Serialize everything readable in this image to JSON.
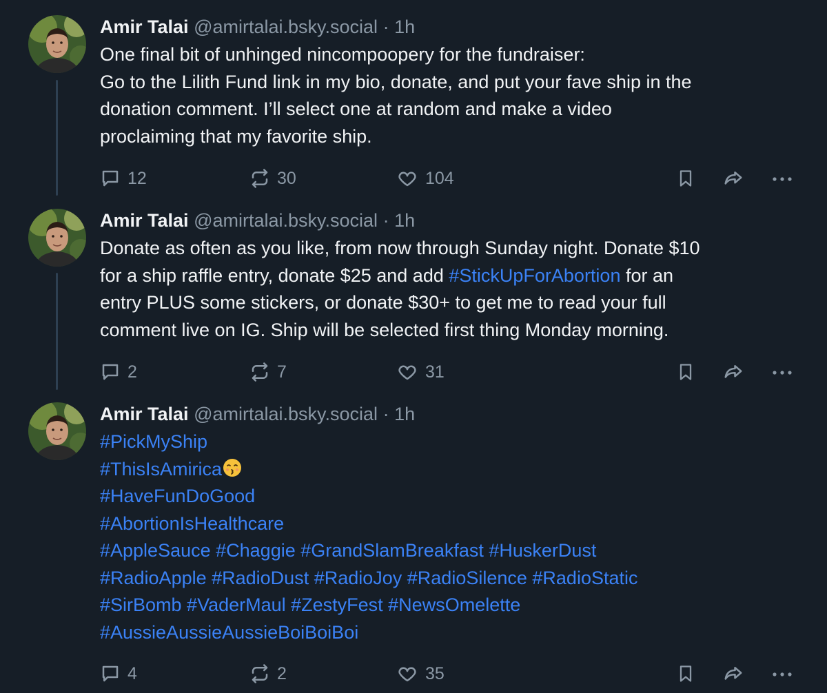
{
  "posts": [
    {
      "author": "Amir Talai",
      "handle": "@amirtalai.bsky.social",
      "separator": "·",
      "time": "1h",
      "lines": [
        "One final bit of unhinged nincompoopery for the fundraiser:",
        "Go to the Lilith Fund link in my bio, donate, and put your fave ship in the",
        "donation comment. I’ll select one at random and make a video",
        "proclaiming that my favorite ship."
      ],
      "replies": "12",
      "reposts": "30",
      "likes": "104"
    },
    {
      "author": "Amir Talai",
      "handle": "@amirtalai.bsky.social",
      "separator": "·",
      "time": "1h",
      "line1": "Donate as often as you like, from now through Sunday night. Donate $10",
      "line2_before": "for a ship raffle entry, donate $25 and add ",
      "line2_tag": "#StickUpForAbortion",
      "line2_after": " for an",
      "line3": "entry PLUS some stickers, or donate $30+ to get me to read your full",
      "line4": "comment live on IG. Ship will be selected first thing Monday morning.",
      "replies": "2",
      "reposts": "7",
      "likes": "31"
    },
    {
      "author": "Amir Talai",
      "handle": "@amirtalai.bsky.social",
      "separator": "·",
      "time": "1h",
      "tag_lines": [
        "#PickMyShip",
        "#ThisIsAmirica",
        "#HaveFunDoGood",
        "#AbortionIsHealthcare",
        "#AppleSauce #Chaggie #GrandSlamBreakfast #HuskerDust",
        "#RadioApple #RadioDust #RadioJoy #RadioSilence #RadioStatic",
        "#SirBomb #VaderMaul #ZestyFest #NewsOmelette",
        "#AussieAussieAussieBoiBoiBoi"
      ],
      "emoji": "kissing-face-emoji",
      "replies": "4",
      "reposts": "2",
      "likes": "35"
    }
  ],
  "icons": {
    "reply": "speech-bubble-icon",
    "repost": "repost-arrows-icon",
    "like": "heart-icon",
    "bookmark": "bookmark-icon",
    "share": "share-arrow-icon",
    "more": "more-dots-icon"
  },
  "colors": {
    "background": "#161e27",
    "text": "#f1f3f5",
    "muted": "#8b98a5",
    "hashtag": "#3b82f6",
    "thread_line": "#2e4052"
  }
}
